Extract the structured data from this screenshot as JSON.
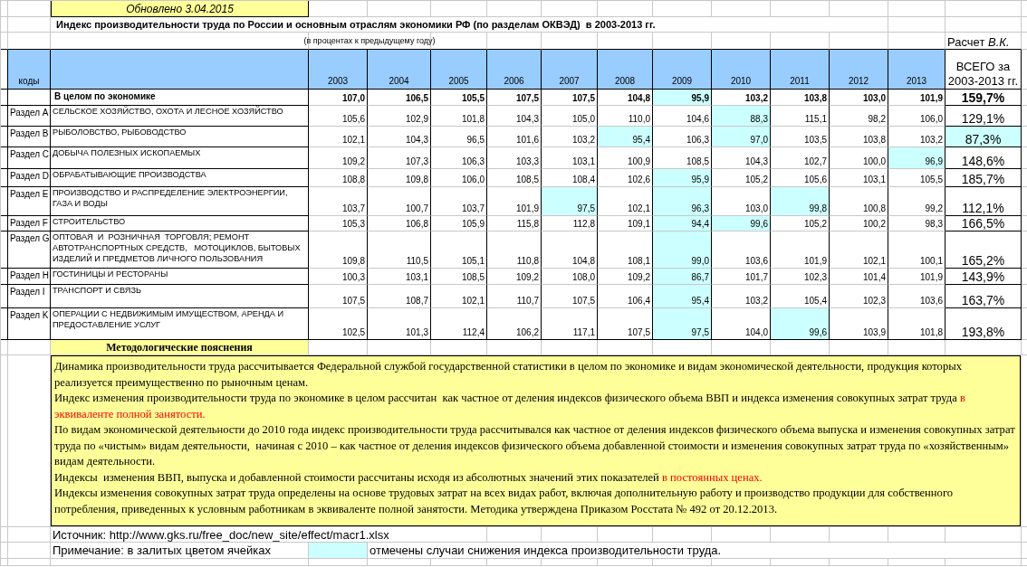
{
  "updated": "Обновлено 3.04.2015",
  "title": "Индекс производительности труда по России и основным отраслям экономики РФ (по разделам ОКВЭД)  в 2003-2013 гг.",
  "subtitle": "(в процентах к предыдущему году)",
  "author": "Расчет *В.К.*",
  "code_header": "коды",
  "years": [
    "2003",
    "2004",
    "2005",
    "2006",
    "2007",
    "2008",
    "2009",
    "2010",
    "2011",
    "2012",
    "2013"
  ],
  "total_header": "ВСЕГО за 2003-2013 гг.",
  "rows": [
    {
      "kind": "summary",
      "name": "В целом по экономике",
      "values": [
        {
          "text": "107,0",
          "highlighted": false
        },
        {
          "text": "106,5",
          "highlighted": false
        },
        {
          "text": "105,5",
          "highlighted": false
        },
        {
          "text": "107,5",
          "highlighted": false
        },
        {
          "text": "107,5",
          "highlighted": false
        },
        {
          "text": "104,8",
          "highlighted": false
        },
        {
          "text": "95,9",
          "highlighted": true
        },
        {
          "text": "103,2",
          "highlighted": false
        },
        {
          "text": "103,8",
          "highlighted": false
        },
        {
          "text": "103,0",
          "highlighted": false
        },
        {
          "text": "101,9",
          "highlighted": false
        }
      ],
      "total": {
        "text": "159,7%",
        "highlighted": false
      }
    },
    {
      "kind": "section",
      "code": "Раздел A",
      "name": "СЕЛЬСКОЕ ХОЗЯЙСТВО, ОХОТА И ЛЕСНОЕ ХОЗЯЙСТВО",
      "values": [
        {
          "text": "105,6",
          "highlighted": false
        },
        {
          "text": "102,9",
          "highlighted": false
        },
        {
          "text": "101,8",
          "highlighted": false
        },
        {
          "text": "104,3",
          "highlighted": false
        },
        {
          "text": "105,0",
          "highlighted": false
        },
        {
          "text": "110,0",
          "highlighted": false
        },
        {
          "text": "104,6",
          "highlighted": false
        },
        {
          "text": "88,3",
          "highlighted": true
        },
        {
          "text": "115,1",
          "highlighted": false
        },
        {
          "text": "98,2",
          "highlighted": false
        },
        {
          "text": "106,0",
          "highlighted": false
        }
      ],
      "total": {
        "text": "129,1%",
        "highlighted": false
      }
    },
    {
      "kind": "section",
      "code": "Раздел B",
      "name": "РЫБОЛОВСТВО, РЫБОВОДСТВО",
      "values": [
        {
          "text": "102,1",
          "highlighted": false
        },
        {
          "text": "104,3",
          "highlighted": false
        },
        {
          "text": "96,5",
          "highlighted": false
        },
        {
          "text": "101,6",
          "highlighted": false
        },
        {
          "text": "103,2",
          "highlighted": false
        },
        {
          "text": "95,4",
          "highlighted": true
        },
        {
          "text": "106,3",
          "highlighted": false
        },
        {
          "text": "97,0",
          "highlighted": true
        },
        {
          "text": "103,5",
          "highlighted": false
        },
        {
          "text": "103,8",
          "highlighted": false
        },
        {
          "text": "103,2",
          "highlighted": false
        }
      ],
      "total": {
        "text": "87,3%",
        "highlighted": true
      }
    },
    {
      "kind": "section",
      "code": "Раздел C",
      "name": "ДОБЫЧА ПОЛЕЗНЫХ ИСКОПАЕМЫХ",
      "values": [
        {
          "text": "109,2",
          "highlighted": false
        },
        {
          "text": "107,3",
          "highlighted": false
        },
        {
          "text": "106,3",
          "highlighted": false
        },
        {
          "text": "103,3",
          "highlighted": false
        },
        {
          "text": "103,1",
          "highlighted": false
        },
        {
          "text": "100,9",
          "highlighted": false
        },
        {
          "text": "108,5",
          "highlighted": false
        },
        {
          "text": "104,3",
          "highlighted": false
        },
        {
          "text": "102,7",
          "highlighted": false
        },
        {
          "text": "100,0",
          "highlighted": false
        },
        {
          "text": "96,9",
          "highlighted": true
        }
      ],
      "total": {
        "text": "148,6%",
        "highlighted": false
      }
    },
    {
      "kind": "section",
      "code": "Раздел D",
      "name": "ОБРАБАТЫВАЮЩИЕ ПРОИЗВОДСТВА",
      "values": [
        {
          "text": "108,8",
          "highlighted": false
        },
        {
          "text": "109,8",
          "highlighted": false
        },
        {
          "text": "106,0",
          "highlighted": false
        },
        {
          "text": "108,5",
          "highlighted": false
        },
        {
          "text": "108,4",
          "highlighted": false
        },
        {
          "text": "102,6",
          "highlighted": false
        },
        {
          "text": "95,9",
          "highlighted": true
        },
        {
          "text": "105,2",
          "highlighted": false
        },
        {
          "text": "105,6",
          "highlighted": false
        },
        {
          "text": "103,1",
          "highlighted": false
        },
        {
          "text": "105,5",
          "highlighted": false
        }
      ],
      "total": {
        "text": "185,7%",
        "highlighted": false
      }
    },
    {
      "kind": "section",
      "code": "Раздел E",
      "name": "ПРОИЗВОДСТВО И РАСПРЕДЕЛЕНИЕ ЭЛЕКТРОЭНЕРГИИ, ГАЗА И ВОДЫ",
      "values": [
        {
          "text": "103,7",
          "highlighted": false
        },
        {
          "text": "100,7",
          "highlighted": false
        },
        {
          "text": "103,7",
          "highlighted": false
        },
        {
          "text": "101,9",
          "highlighted": false
        },
        {
          "text": "97,5",
          "highlighted": true
        },
        {
          "text": "102,1",
          "highlighted": false
        },
        {
          "text": "96,3",
          "highlighted": true
        },
        {
          "text": "103,0",
          "highlighted": false
        },
        {
          "text": "99,8",
          "highlighted": true
        },
        {
          "text": "100,8",
          "highlighted": false
        },
        {
          "text": "99,2",
          "highlighted": false
        }
      ],
      "total": {
        "text": "112,1%",
        "highlighted": false
      }
    },
    {
      "kind": "section",
      "code": "Раздел F",
      "name": "СТРОИТЕЛЬСТВО",
      "values": [
        {
          "text": "105,3",
          "highlighted": false
        },
        {
          "text": "106,8",
          "highlighted": false
        },
        {
          "text": "105,9",
          "highlighted": false
        },
        {
          "text": "115,8",
          "highlighted": false
        },
        {
          "text": "112,8",
          "highlighted": false
        },
        {
          "text": "109,1",
          "highlighted": false
        },
        {
          "text": "94,4",
          "highlighted": true
        },
        {
          "text": "99,6",
          "highlighted": true
        },
        {
          "text": "105,2",
          "highlighted": false
        },
        {
          "text": "100,2",
          "highlighted": false
        },
        {
          "text": "98,3",
          "highlighted": false
        }
      ],
      "total": {
        "text": "166,5%",
        "highlighted": false
      }
    },
    {
      "kind": "section",
      "code": "Раздел G",
      "name": "ОПТОВАЯ  И  РОЗНИЧНАЯ  ТОРГОВЛЯ; РЕМОНТ АВТОТРАНСПОРТНЫХ СРЕДСТВ,   МОТОЦИКЛОВ, БЫТОВЫХ ИЗДЕЛИЙ И ПРЕДМЕТОВ ЛИЧНОГО ПОЛЬЗОВАНИЯ",
      "values": [
        {
          "text": "109,8",
          "highlighted": false
        },
        {
          "text": "110,5",
          "highlighted": false
        },
        {
          "text": "105,1",
          "highlighted": false
        },
        {
          "text": "110,8",
          "highlighted": false
        },
        {
          "text": "104,8",
          "highlighted": false
        },
        {
          "text": "108,1",
          "highlighted": false
        },
        {
          "text": "99,0",
          "highlighted": true
        },
        {
          "text": "103,6",
          "highlighted": false
        },
        {
          "text": "101,9",
          "highlighted": false
        },
        {
          "text": "102,1",
          "highlighted": false
        },
        {
          "text": "100,1",
          "highlighted": false
        }
      ],
      "total": {
        "text": "165,2%",
        "highlighted": false
      }
    },
    {
      "kind": "section",
      "code": "Раздел H",
      "name": "ГОСТИНИЦЫ И РЕСТОРАНЫ",
      "values": [
        {
          "text": "100,3",
          "highlighted": false
        },
        {
          "text": "103,1",
          "highlighted": false
        },
        {
          "text": "108,5",
          "highlighted": false
        },
        {
          "text": "109,2",
          "highlighted": false
        },
        {
          "text": "108,0",
          "highlighted": false
        },
        {
          "text": "109,2",
          "highlighted": false
        },
        {
          "text": "86,7",
          "highlighted": true
        },
        {
          "text": "101,7",
          "highlighted": false
        },
        {
          "text": "102,3",
          "highlighted": false
        },
        {
          "text": "101,4",
          "highlighted": false
        },
        {
          "text": "101,9",
          "highlighted": false
        }
      ],
      "total": {
        "text": "143,9%",
        "highlighted": false
      }
    },
    {
      "kind": "section",
      "code": "Раздел I",
      "name": "ТРАНСПОРТ И СВЯЗЬ",
      "values": [
        {
          "text": "107,5",
          "highlighted": false
        },
        {
          "text": "108,7",
          "highlighted": false
        },
        {
          "text": "102,1",
          "highlighted": false
        },
        {
          "text": "110,7",
          "highlighted": false
        },
        {
          "text": "107,5",
          "highlighted": false
        },
        {
          "text": "106,4",
          "highlighted": false
        },
        {
          "text": "95,4",
          "highlighted": true
        },
        {
          "text": "103,2",
          "highlighted": false
        },
        {
          "text": "105,4",
          "highlighted": false
        },
        {
          "text": "102,3",
          "highlighted": false
        },
        {
          "text": "103,6",
          "highlighted": false
        }
      ],
      "total": {
        "text": "163,7%",
        "highlighted": false
      }
    },
    {
      "kind": "section",
      "code": "Раздел K",
      "name": "ОПЕРАЦИИ С НЕДВИЖИМЫМ ИМУЩЕСТВОМ, АРЕНДА И ПРЕДОСТАВЛЕНИЕ УСЛУГ",
      "values": [
        {
          "text": "102,5",
          "highlighted": false
        },
        {
          "text": "101,3",
          "highlighted": false
        },
        {
          "text": "112,4",
          "highlighted": false
        },
        {
          "text": "106,2",
          "highlighted": false
        },
        {
          "text": "117,1",
          "highlighted": false
        },
        {
          "text": "107,5",
          "highlighted": false
        },
        {
          "text": "97,5",
          "highlighted": true
        },
        {
          "text": "104,0",
          "highlighted": false
        },
        {
          "text": "99,6",
          "highlighted": true
        },
        {
          "text": "103,9",
          "highlighted": false
        },
        {
          "text": "101,8",
          "highlighted": false
        }
      ],
      "total": {
        "text": "193,8%",
        "highlighted": false
      }
    }
  ],
  "notes_title": "Методологические пояснения",
  "notes": [
    {
      "segments": [
        {
          "text": "Динамика производительности труда рассчитывается Федеральной службой государственной статистики в целом по экономике и видам экономической деятельности, продукция которых реализуется преимущественно по рыночным ценам.",
          "emphasized": false
        }
      ]
    },
    {
      "segments": [
        {
          "text": "Индекс изменения производительности труда по экономике в целом рассчитан  как частное от деления индексов физического объема ВВП и индекса изменения совокупных затрат труда ",
          "emphasized": false
        },
        {
          "text": "в эквиваленте полной занятости.",
          "emphasized": true
        }
      ]
    },
    {
      "segments": [
        {
          "text": "По видам экономической деятельности до 2010 года индекс производительности труда рассчитывался как частное от деления индексов физического объема выпуска и изменения совокупных затрат труда по «чистым» видам деятельности,  начиная с 2010 – как частное от деления индексов физического объема добавленной стоимости и изменения совокупных затрат труда по «хозяйственным» видам деятельности.",
          "emphasized": false
        }
      ]
    },
    {
      "segments": [
        {
          "text": "Индексы  изменения ВВП, выпуска и добавленной стоимости рассчитаны исходя из абсолютных значений этих показателей ",
          "emphasized": false
        },
        {
          "text": "в постоянных ценах.",
          "emphasized": true
        }
      ]
    },
    {
      "segments": [
        {
          "text": "Индексы изменения совокупных затрат труда определены на основе трудовых затрат на всех видах работ, включая дополнительную работу и производство продукции для собственного потребления, приведенных к условным работникам в эквиваленте полной занятости. Методика утверждена Приказом Росстата № 492 от 20.12.2013.",
          "emphasized": false
        }
      ]
    }
  ],
  "source": "Источник: http://www.gks.ru/free_doc/new_site/effect/macr1.xlsx",
  "legend": {
    "before": "Примечание: в залитых цветом ячейках",
    "after": "отмечены случаи снижения индекса производительности труда."
  }
}
